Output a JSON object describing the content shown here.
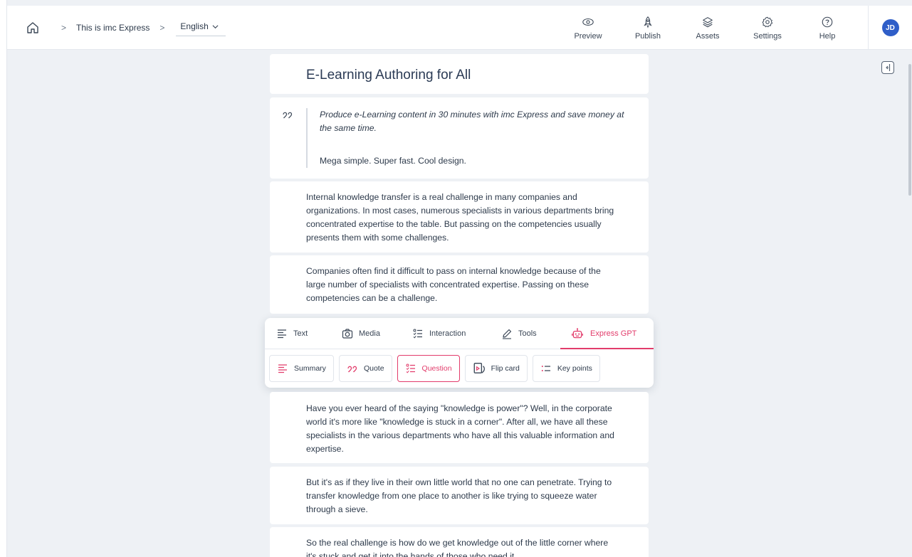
{
  "breadcrumb": {
    "course": "This is imc Express",
    "language": "English"
  },
  "nav": [
    {
      "label": "Preview",
      "icon": "eye-icon"
    },
    {
      "label": "Publish",
      "icon": "rocket-icon"
    },
    {
      "label": "Assets",
      "icon": "layers-icon"
    },
    {
      "label": "Settings",
      "icon": "gear-icon"
    },
    {
      "label": "Help",
      "icon": "help-icon"
    }
  ],
  "user": {
    "initials": "JD"
  },
  "content": {
    "title": "E-Learning Authoring for All",
    "quote": {
      "text": "Produce e-Learning content in 30 minutes with imc Express and save money at the same time.",
      "sub": "Mega simple. Super fast. Cool design."
    },
    "paragraphs": [
      "Internal knowledge transfer is a real challenge in many companies and organizations. In most cases, numerous specialists in various departments bring concentrated expertise to the table. But passing on the competencies usually presents them with some challenges.",
      "Companies often find it difficult to pass on internal knowledge because of the large number of specialists with concentrated expertise. Passing on these competencies can be a challenge.",
      "Have you ever heard of the saying \"knowledge is power\"? Well, in the corporate world it's more like \"knowledge is stuck in a corner\". After all, we have all these specialists in the various departments who have all this valuable information and expertise.",
      "But it's as if they live in their own little world that no one can penetrate. Trying to transfer knowledge from one place to another is like trying to squeeze water through a sieve.",
      "So the real challenge is how do we get knowledge out of the little corner where it's stuck and get it into the hands of those who need it."
    ]
  },
  "toolbar": {
    "tabs": [
      {
        "label": "Text",
        "icon": "text-lines-icon"
      },
      {
        "label": "Media",
        "icon": "camera-icon"
      },
      {
        "label": "Interaction",
        "icon": "checklist-icon"
      },
      {
        "label": "Tools",
        "icon": "pencil-icon"
      },
      {
        "label": "Express GPT",
        "icon": "robot-icon",
        "active": true
      }
    ],
    "chips": [
      {
        "label": "Summary",
        "icon": "summary-icon"
      },
      {
        "label": "Quote",
        "icon": "quote-icon"
      },
      {
        "label": "Question",
        "icon": "question-list-icon",
        "active": true
      },
      {
        "label": "Flip card",
        "icon": "flip-card-icon"
      },
      {
        "label": "Key points",
        "icon": "key-points-icon"
      }
    ]
  },
  "colors": {
    "accent": "#e23c6b",
    "avatar": "#2f5ec8",
    "background": "#eef1f5"
  }
}
